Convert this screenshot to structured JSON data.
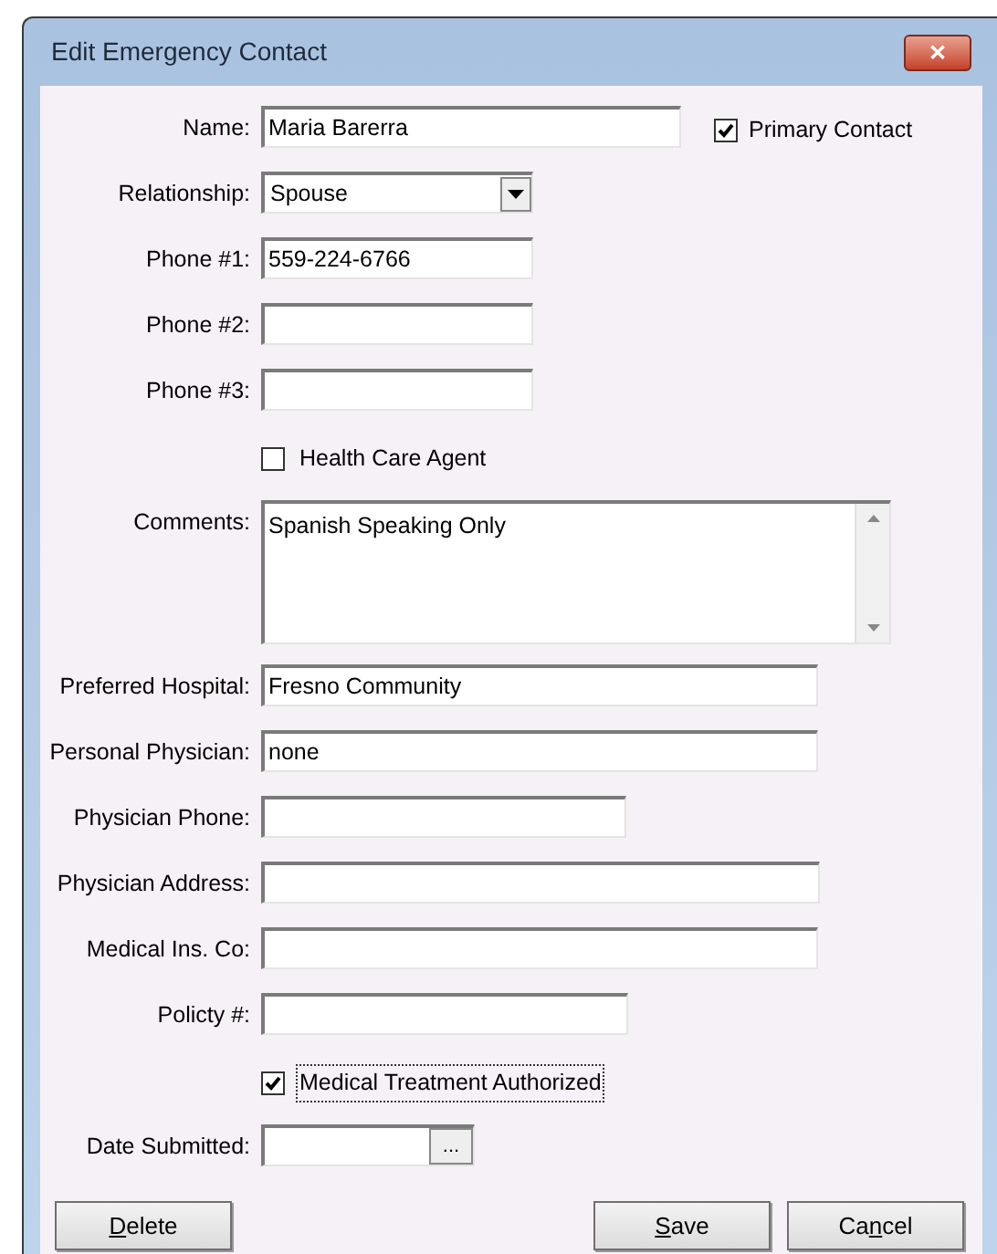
{
  "window": {
    "title": "Edit Emergency Contact",
    "close_button": "✕"
  },
  "fields": [
    {
      "kind": "text",
      "label": "Name:",
      "value": "Maria Barerra",
      "extra": {
        "label": "Primary Contact",
        "checked": true
      }
    },
    {
      "kind": "dropdown",
      "label": "Relationship:",
      "value": "Spouse"
    },
    {
      "kind": "text",
      "label": "Phone #1:",
      "value": "559-224-6766"
    },
    {
      "kind": "text",
      "label": "Phone #2:"
    },
    {
      "kind": "text",
      "label": "Phone #3:"
    },
    {
      "kind": "checkbox",
      "label": "Health Care Agent",
      "checked": false,
      "focused": false
    },
    {
      "kind": "textarea",
      "label": "Comments:",
      "value": "Spanish Speaking Only"
    },
    {
      "kind": "text",
      "label": "Preferred Hospital:",
      "value": "Fresno Community"
    },
    {
      "kind": "text",
      "label": "Personal Physician:",
      "value": "none"
    },
    {
      "kind": "text",
      "label": "Physician Phone:"
    },
    {
      "kind": "text",
      "label": "Physician Address:"
    },
    {
      "kind": "text",
      "label": "Medical Ins. Co:"
    },
    {
      "kind": "text",
      "label": "Policty #:"
    },
    {
      "kind": "checkbox",
      "label": "Medical Treatment Authorized",
      "checked": true,
      "focused": true
    },
    {
      "kind": "date",
      "label": "Date Submitted:",
      "button": "..."
    }
  ],
  "buttons": [
    {
      "access_key": "D",
      "after": "elete"
    },
    {
      "access_key": "S",
      "after": "ave"
    },
    {
      "before": "Ca",
      "access_key": "n",
      "after": "cel"
    }
  ]
}
